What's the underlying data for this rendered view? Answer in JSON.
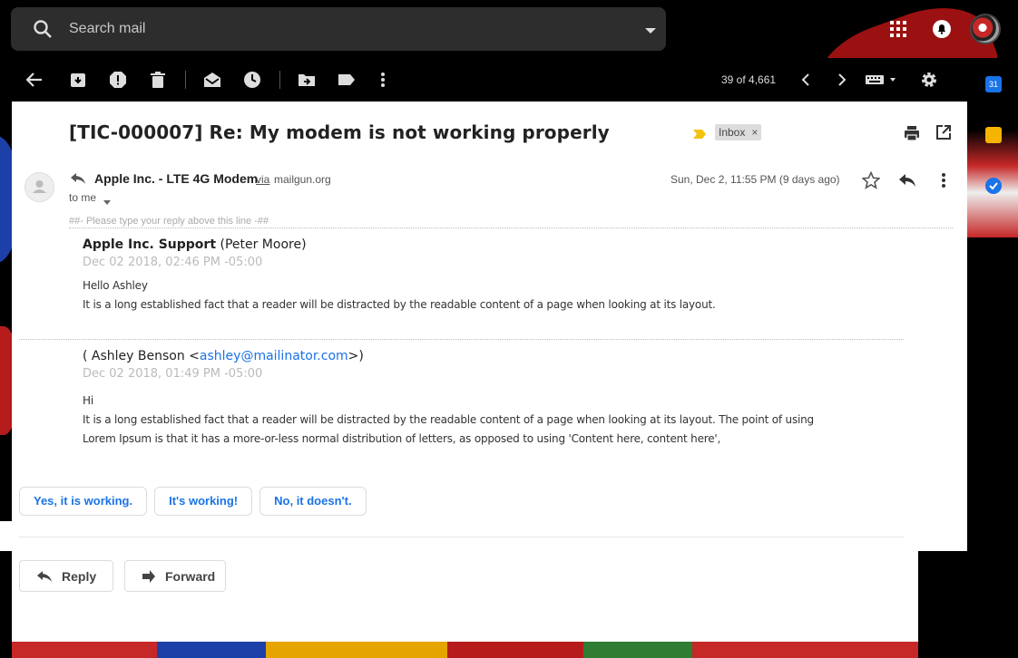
{
  "search": {
    "placeholder": "Search mail"
  },
  "toolbar": {
    "pager_text": "39 of 4,661"
  },
  "email": {
    "subject": "[TIC-000007] Re: My modem is not working properly",
    "label": "Inbox",
    "label_close": "×",
    "sender_name": "Apple Inc. - LTE 4G Modem",
    "via": "via",
    "via_domain": "mailgun.org",
    "to": "to me",
    "date": "Sun, Dec 2, 11:55 PM (9 days ago)",
    "reply_marker": "##- Please type your reply above this line -##"
  },
  "messages": [
    {
      "from_bold": "Apple Inc. Support",
      "from_rest": " (Peter Moore)",
      "date": "Dec 02 2018, 02:46 PM -05:00",
      "lines": [
        "Hello Ashley",
        "It is a long established fact that a reader will be distracted by the readable content of a page when looking at its layout."
      ]
    },
    {
      "from_prefix": "( Ashley Benson <",
      "from_email": "ashley@mailinator.com",
      "from_suffix": ">)",
      "date": "Dec 02 2018, 01:49 PM -05:00",
      "lines": [
        "Hi",
        "It is a long established fact that a reader will be distracted by the readable content of a page when looking at its layout. The point of using",
        "Lorem Ipsum is that it has a more-or-less normal distribution of letters, as opposed to using 'Content here, content here',"
      ]
    }
  ],
  "smart_replies": [
    "Yes, it is working.",
    "It's working!",
    "No, it doesn't."
  ],
  "actions": {
    "reply": "Reply",
    "forward": "Forward"
  },
  "side_icons": [
    "calendar-icon",
    "keep-icon",
    "tasks-icon"
  ],
  "calendar_day": "31",
  "colors": {
    "accent": "#1a73e8",
    "label_bg": "#dddddd",
    "important": "#f4c20d"
  }
}
